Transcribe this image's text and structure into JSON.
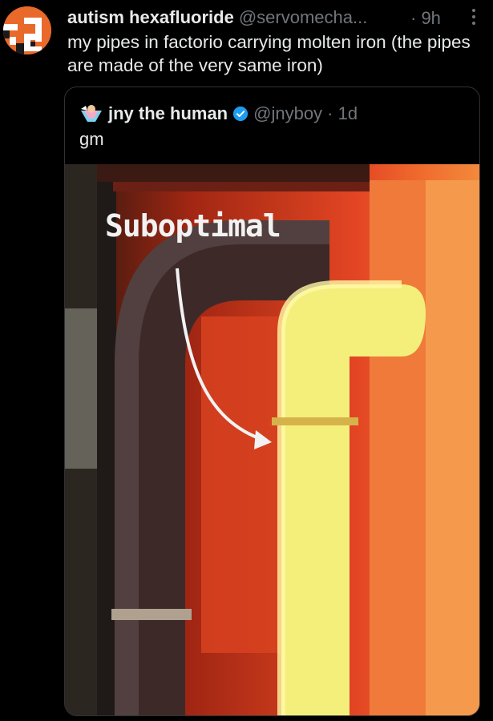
{
  "tweet": {
    "display_name": "autism hexafluoride",
    "handle": "@servomecha...",
    "time": "· 9h",
    "text": "my pipes in factorio carrying molten iron (the pipes are made of the very same iron)"
  },
  "quoted_tweet": {
    "display_name": "jny the human",
    "handle": "@jnyboy · 1d",
    "text": "gm",
    "image_caption": "Suboptimal"
  },
  "colors": {
    "background": "#000000",
    "text_primary": "#e7e9ea",
    "text_secondary": "#71767b",
    "verified": "#1d9bf0",
    "card_border": "#2f3336"
  },
  "icons": {
    "more": "more-vertical-icon",
    "verified": "verified-badge-icon"
  }
}
